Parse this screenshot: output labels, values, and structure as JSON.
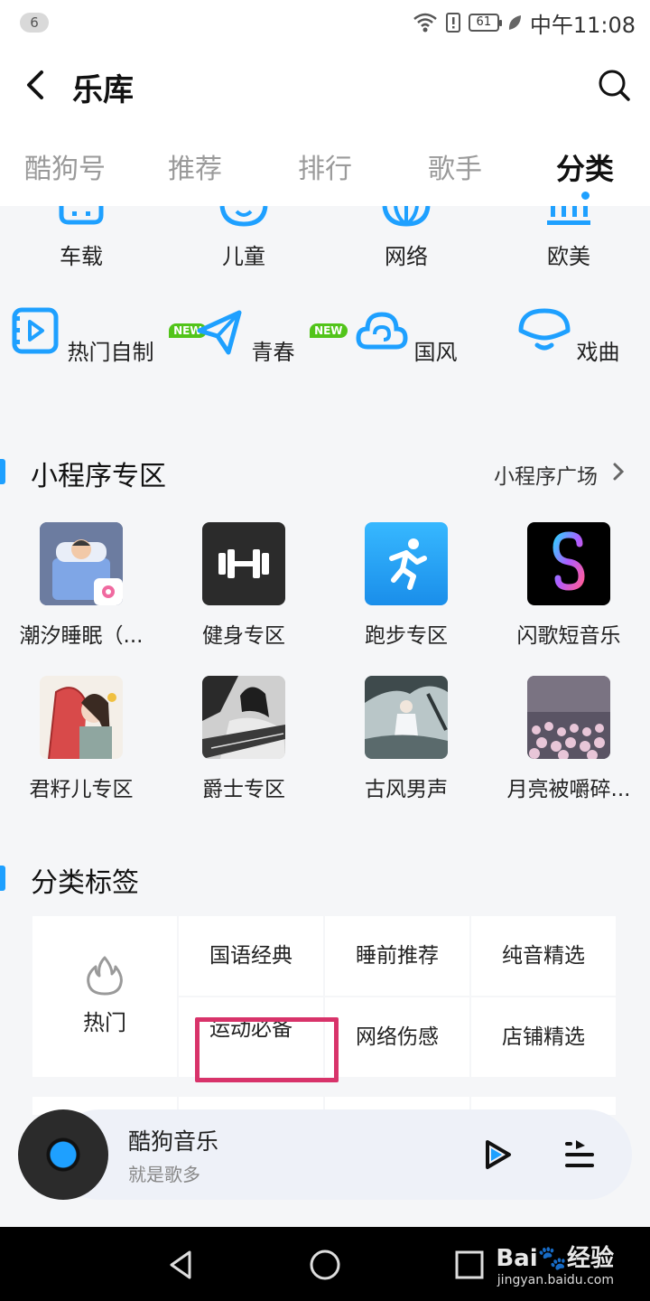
{
  "status_bar": {
    "notification_count": "6",
    "battery": "61",
    "time": "中午11:08"
  },
  "header": {
    "title": "乐库"
  },
  "tabs": [
    {
      "label": "酷狗号",
      "active": false
    },
    {
      "label": "推荐",
      "active": false
    },
    {
      "label": "排行",
      "active": false
    },
    {
      "label": "歌手",
      "active": false
    },
    {
      "label": "分类",
      "active": true
    }
  ],
  "categories_row1": [
    {
      "label": "车载",
      "icon": "car-icon"
    },
    {
      "label": "儿童",
      "icon": "child-icon"
    },
    {
      "label": "网络",
      "icon": "globe-icon"
    },
    {
      "label": "欧美",
      "icon": "bars-icon"
    }
  ],
  "categories_row2": [
    {
      "label": "热门自制",
      "icon": "video-play-icon",
      "badge": "NEW"
    },
    {
      "label": "青春",
      "icon": "paper-plane-icon",
      "badge": "NEW"
    },
    {
      "label": "国风",
      "icon": "cloud-swirl-icon"
    },
    {
      "label": "戏曲",
      "icon": "fan-icon"
    }
  ],
  "mini_programs": {
    "title": "小程序专区",
    "more_label": "小程序广场",
    "items": [
      {
        "label": "潮汐睡眠（...",
        "thumb": "sleep-thumb"
      },
      {
        "label": "健身专区",
        "thumb": "dumbbell-thumb"
      },
      {
        "label": "跑步专区",
        "thumb": "runner-thumb"
      },
      {
        "label": "闪歌短音乐",
        "thumb": "flash-song-thumb"
      },
      {
        "label": "君籽儿专区",
        "thumb": "artist-thumb"
      },
      {
        "label": "爵士专区",
        "thumb": "jazz-thumb"
      },
      {
        "label": "古风男声",
        "thumb": "ancient-style-thumb"
      },
      {
        "label": "月亮被嚼碎...",
        "thumb": "flowers-thumb"
      }
    ]
  },
  "tags": {
    "title": "分类标签",
    "hot_label": "热门",
    "items": [
      "国语经典",
      "睡前推荐",
      "纯音精选",
      "运动必备",
      "网络伤感",
      "店铺精选"
    ]
  },
  "player": {
    "title": "酷狗音乐",
    "subtitle": "就是歌多"
  },
  "watermark": {
    "brand": "Bai🐾经验",
    "url": "jingyan.baidu.com"
  },
  "colors": {
    "accent": "#1ea0ff",
    "highlight": "#d8336a",
    "new_badge": "#52c41a"
  }
}
